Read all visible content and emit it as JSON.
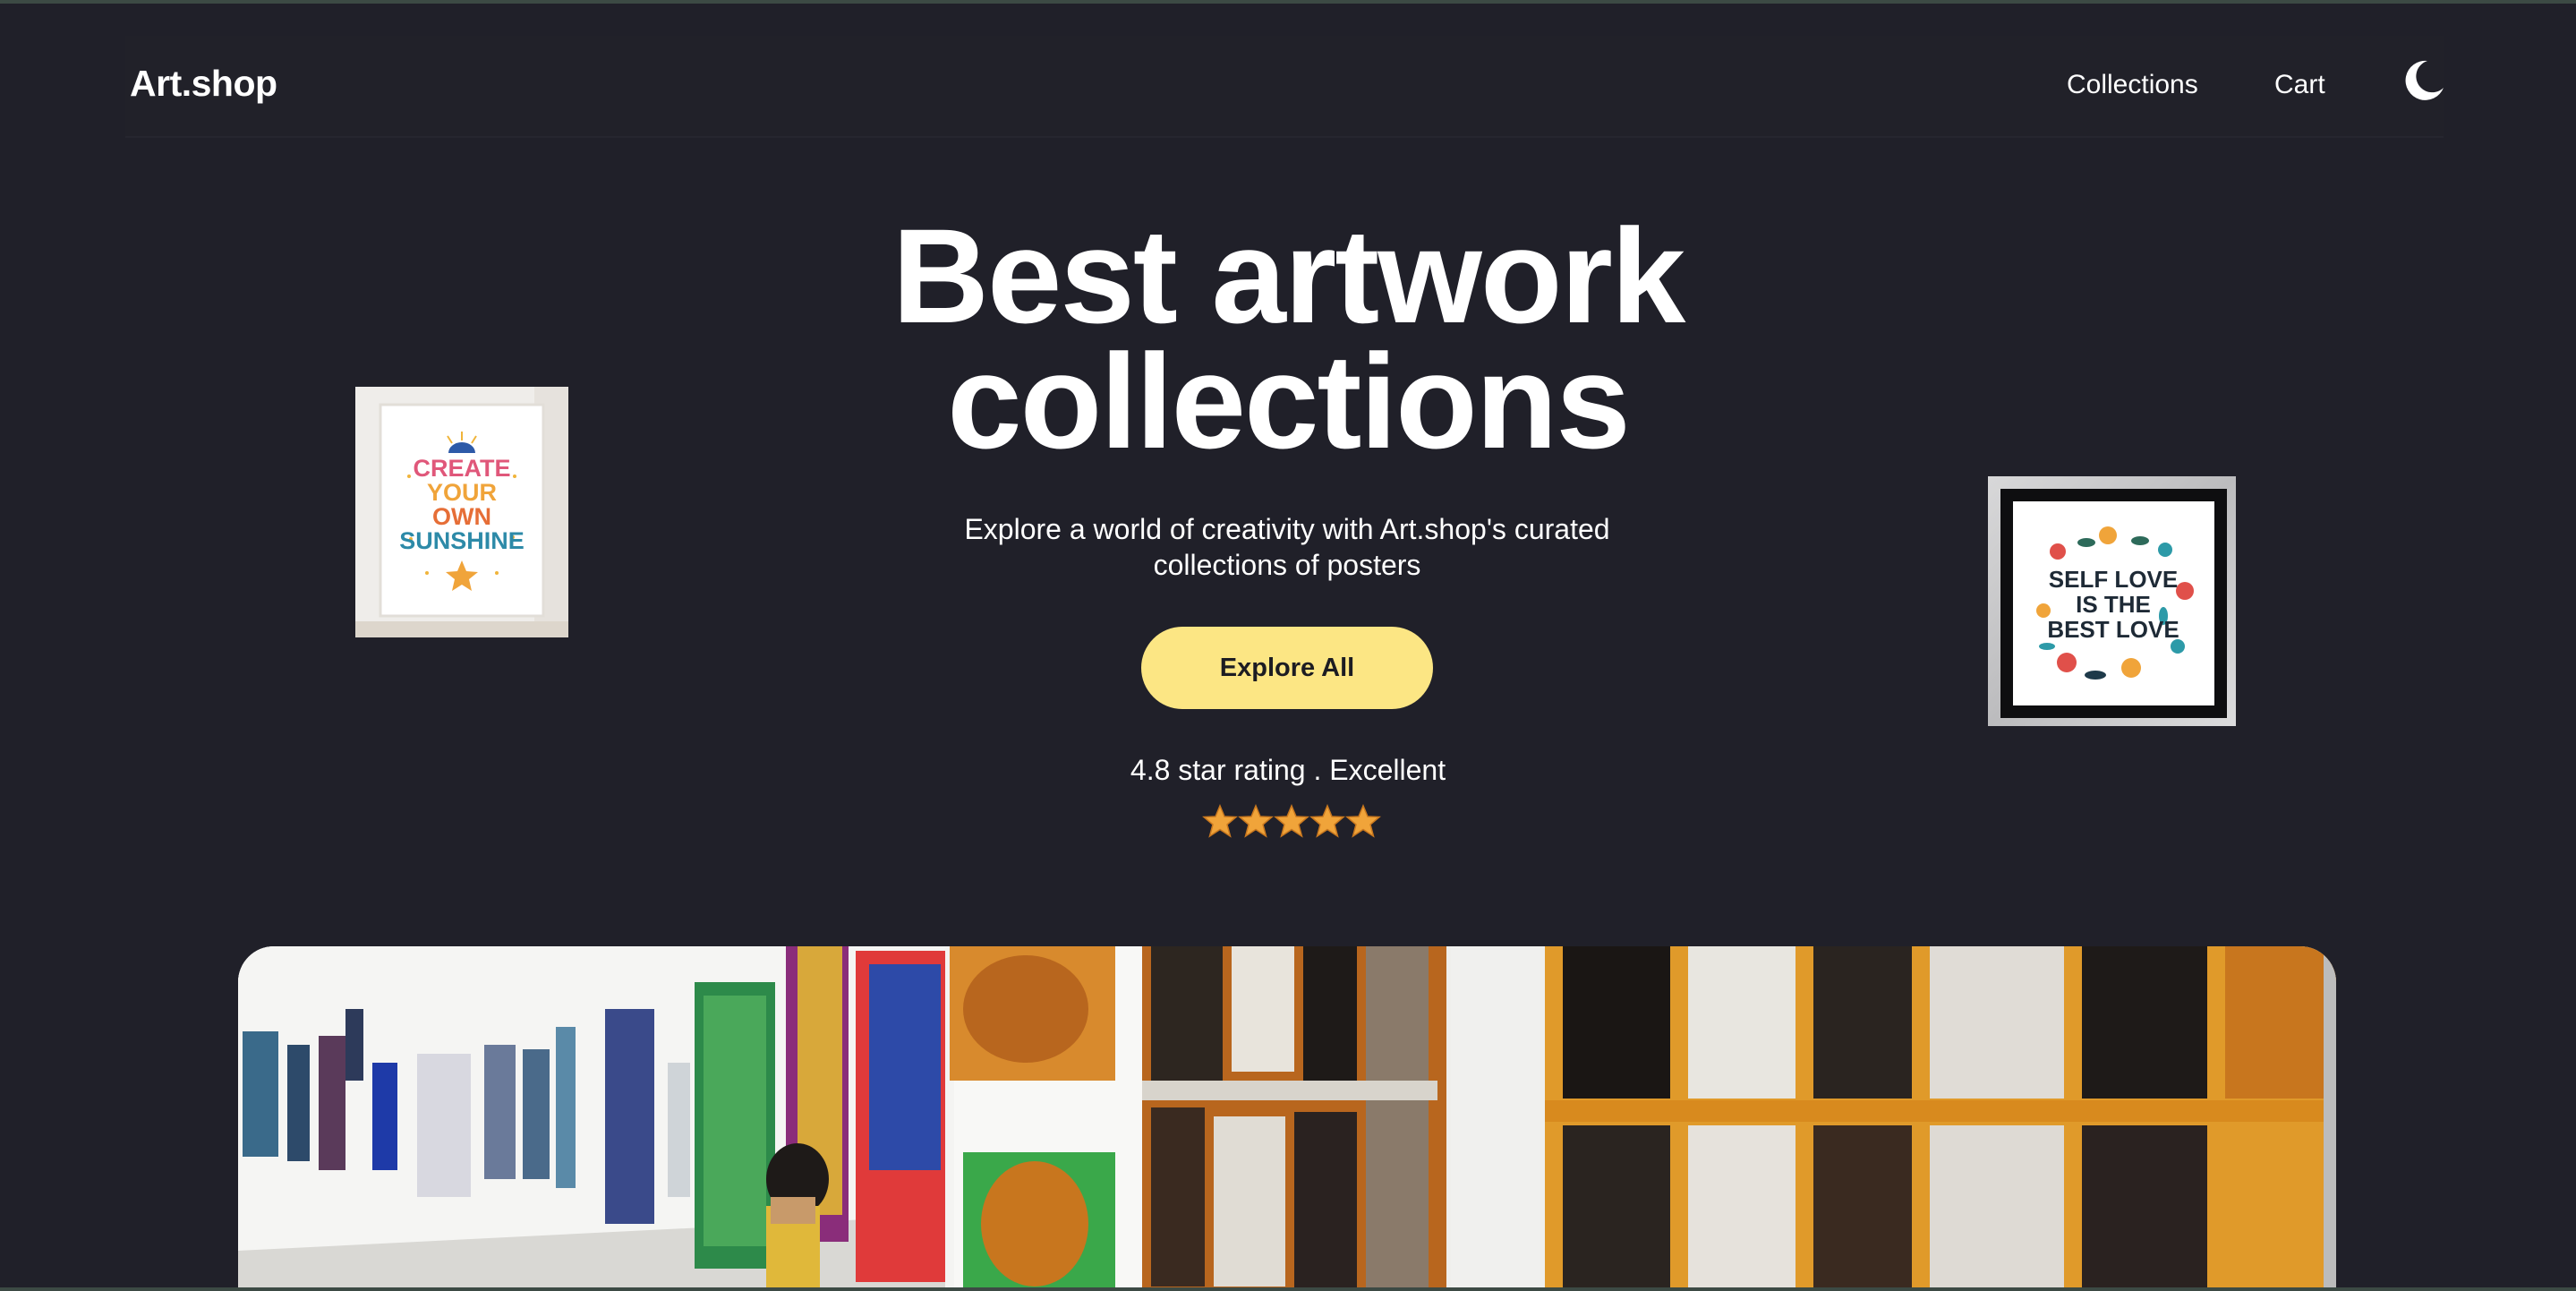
{
  "header": {
    "brand": "Art.shop",
    "nav": [
      {
        "label": "Collections"
      },
      {
        "label": "Cart"
      }
    ],
    "theme_toggle_icon": "moon-icon"
  },
  "hero": {
    "title_line1": "Best artwork",
    "title_line2": "collections",
    "subtitle": "Explore a world of creativity with Art.shop's curated collections of posters",
    "cta_label": "Explore All",
    "rating_text": "4.8 star rating . Excellent",
    "stars": 5,
    "rating": 4.8
  },
  "posters": {
    "left_text": [
      "CREATE",
      "YOUR",
      "OWN",
      "SUNSHINE"
    ],
    "right_text": [
      "SELF LOVE",
      "IS THE",
      "BEST LOVE"
    ]
  },
  "colors": {
    "background": "#202029",
    "cta": "#fce684",
    "star": "#f0a43a"
  }
}
